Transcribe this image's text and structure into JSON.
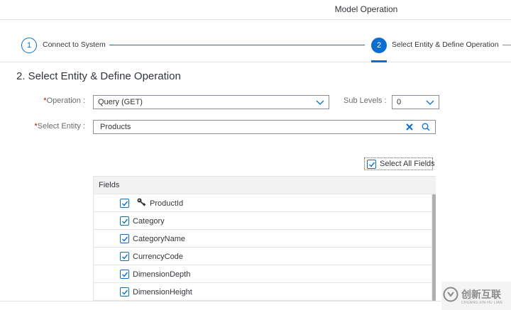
{
  "header": {
    "title": "Model Operation"
  },
  "wizard": {
    "steps": [
      {
        "number": "1",
        "label": "Connect to System",
        "state": "completed"
      },
      {
        "number": "2",
        "label": "Select Entity & Define Operation",
        "state": "active"
      }
    ],
    "accent_color": "#0a6ed1"
  },
  "section": {
    "title": "2. Select Entity & Define Operation"
  },
  "form": {
    "required_marker": "*",
    "operation": {
      "label": "Operation :",
      "value": "Query (GET)"
    },
    "sub_levels": {
      "label": "Sub Levels :",
      "value": "0"
    },
    "entity": {
      "label": "Select Entity :",
      "value": "Products"
    }
  },
  "select_all": {
    "label": "Select All Fields",
    "checked": true
  },
  "fields_table": {
    "header": "Fields",
    "rows": [
      {
        "name": "ProductId",
        "checked": true,
        "is_key": true
      },
      {
        "name": "Category",
        "checked": true,
        "is_key": false
      },
      {
        "name": "CategoryName",
        "checked": true,
        "is_key": false
      },
      {
        "name": "CurrencyCode",
        "checked": true,
        "is_key": false
      },
      {
        "name": "DimensionDepth",
        "checked": true,
        "is_key": false
      },
      {
        "name": "DimensionHeight",
        "checked": true,
        "is_key": false
      }
    ]
  },
  "watermark": {
    "text": "创新互联",
    "subtext": "CHUANG XIN HU LIAN"
  },
  "icons": {
    "dropdown": "chevron-down-icon",
    "clear": "clear-icon",
    "search": "search-icon",
    "key": "key-icon",
    "check": "checkmark-icon"
  }
}
